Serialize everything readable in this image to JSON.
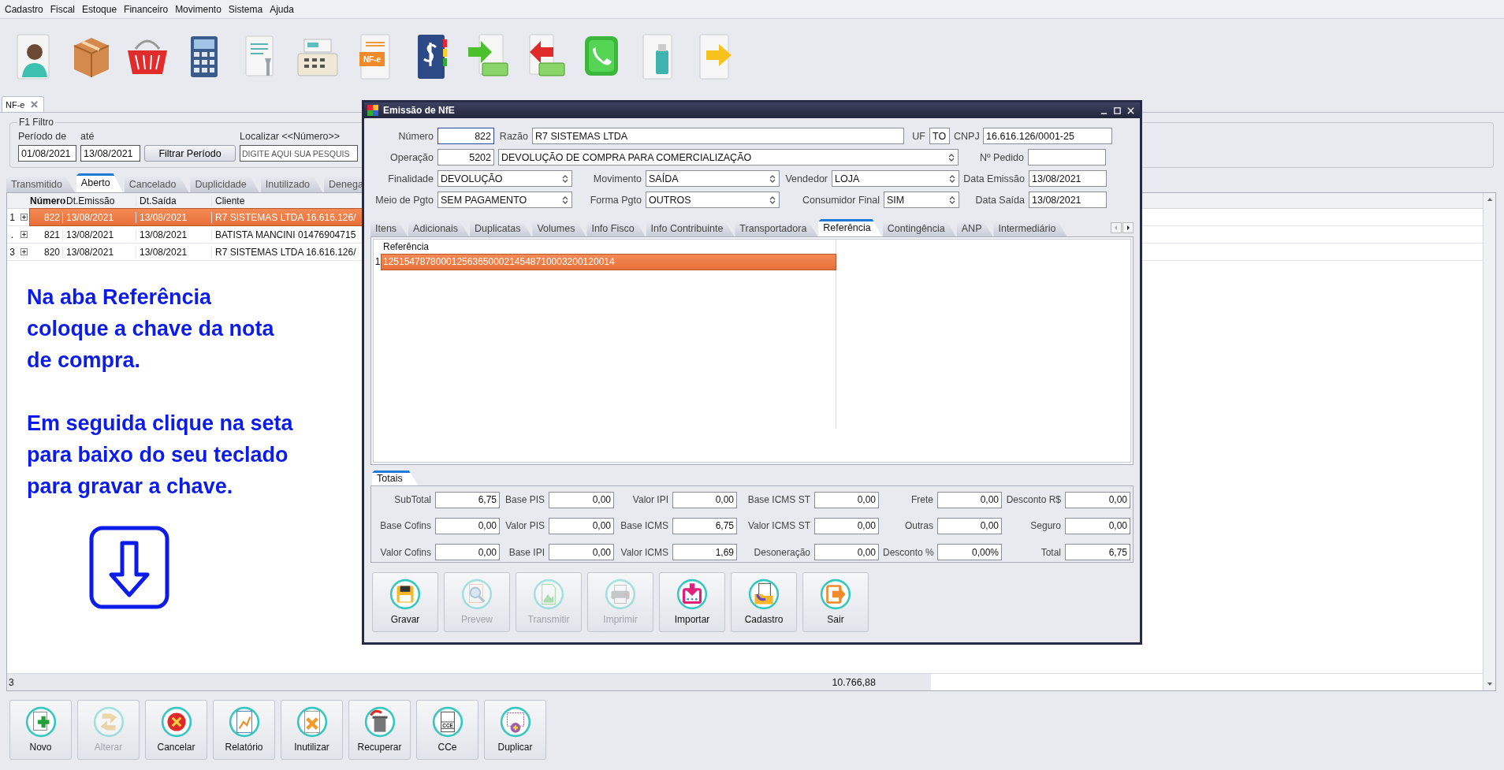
{
  "menu": [
    "Cadastro",
    "Fiscal",
    "Estoque",
    "Financeiro",
    "Movimento",
    "Sistema",
    "Ajuda"
  ],
  "toolbar": {
    "invoice_icon_label": "NF-e"
  },
  "document_tab": {
    "label": "NF-e"
  },
  "filter": {
    "title": "F1 Filtro",
    "from_label": "Período de",
    "from_value": "01/08/2021",
    "to_label": "até",
    "to_value": "13/08/2021",
    "button": "Filtrar Período",
    "search_label": "Localizar <<Número>>",
    "search_placeholder": "DIGITE AQUI SUA PESQUIS"
  },
  "tabs": [
    {
      "label": "Transmitido",
      "selected": false
    },
    {
      "label": "Aberto",
      "selected": true
    },
    {
      "label": "Cancelado",
      "selected": false
    },
    {
      "label": "Duplicidade",
      "selected": false
    },
    {
      "label": "Inutilizado",
      "selected": false
    },
    {
      "label": "Denega",
      "selected": false
    }
  ],
  "table": {
    "columns": [
      "Número",
      "Dt.Emissão",
      "Dt.Saída",
      "Cliente"
    ],
    "rows": [
      {
        "row_number": "1",
        "numero": "822",
        "emissao": "13/08/2021",
        "saida": "13/08/2021",
        "cliente": "R7 SISTEMAS LTDA 16.616.126/",
        "selected": true
      },
      {
        "row_number": ".",
        "numero": "821",
        "emissao": "13/08/2021",
        "saida": "13/08/2021",
        "cliente": "BATISTA MANCINI 01476904715",
        "selected": false
      },
      {
        "row_number": "3",
        "numero": "820",
        "emissao": "13/08/2021",
        "saida": "13/08/2021",
        "cliente": "R7 SISTEMAS LTDA 16.616.126/",
        "selected": false
      }
    ],
    "footer": {
      "count": "3",
      "total": "10.766,88"
    }
  },
  "annotation": {
    "paragraphs": [
      "Na aba Referência\ncoloque a chave da nota\nde compra.",
      "Em seguida clique na seta\npara baixo do seu teclado\npara gravar a chave."
    ]
  },
  "buttons": [
    {
      "label": "Novo",
      "disabled": false
    },
    {
      "label": "Alterar",
      "disabled": true
    },
    {
      "label": "Cancelar",
      "disabled": false
    },
    {
      "label": "Relatório",
      "disabled": false
    },
    {
      "label": "Inutilizar",
      "disabled": false
    },
    {
      "label": "Recuperar",
      "disabled": false
    },
    {
      "label": "CCe",
      "disabled": false,
      "icon_text": "CCE"
    },
    {
      "label": "Duplicar",
      "disabled": false
    }
  ],
  "dialog": {
    "title": "Emissão de NfE",
    "numero": {
      "label": "Número",
      "value": "822"
    },
    "razao": {
      "label": "Razão",
      "value": "R7 SISTEMAS LTDA"
    },
    "uf": {
      "label": "UF",
      "value": "TO"
    },
    "cnpj": {
      "label": "CNPJ",
      "value": "16.616.126/0001-25"
    },
    "operacao": {
      "label": "Operação",
      "code": "5202",
      "value": "DEVOLUÇÃO DE COMPRA PARA COMERCIALIZAÇÃO"
    },
    "pedido": {
      "label": "Nº Pedido"
    },
    "finalidade": {
      "label": "Finalidade",
      "value": "DEVOLUÇÃO"
    },
    "movimento": {
      "label": "Movimento",
      "value": "SAÍDA"
    },
    "vendedor": {
      "label": "Vendedor",
      "value": "LOJA"
    },
    "data_emissao": {
      "label": "Data Emissão",
      "value": "13/08/2021"
    },
    "meio_pgto": {
      "label": "Meio de Pgto",
      "value": "SEM PAGAMENTO"
    },
    "forma_pgto": {
      "label": "Forma Pgto",
      "value": "OUTROS"
    },
    "consumidor_final": {
      "label": "Consumidor Final",
      "value": "SIM"
    },
    "data_saida": {
      "label": "Data Saída",
      "value": "13/08/2021"
    },
    "tabs": [
      {
        "label": "Itens",
        "selected": false
      },
      {
        "label": "Adicionais",
        "selected": false
      },
      {
        "label": "Duplicatas",
        "selected": false
      },
      {
        "label": "Volumes",
        "selected": false
      },
      {
        "label": "Info Fisco",
        "selected": false
      },
      {
        "label": "Info Contribuinte",
        "selected": false
      },
      {
        "label": "Transportadora",
        "selected": false
      },
      {
        "label": "Referência",
        "selected": true
      },
      {
        "label": "Contingência",
        "selected": false
      },
      {
        "label": "ANP",
        "selected": false
      },
      {
        "label": "Intermediário",
        "selected": false
      }
    ],
    "reference": {
      "column": "Referência",
      "rows": [
        {
          "row_number": "1",
          "value": "12515478780001256365000214548710003200120014",
          "selected": true
        }
      ]
    },
    "totals": {
      "tab": "Totais",
      "fields": [
        {
          "label": "SubTotal",
          "value": "6,75"
        },
        {
          "label": "Base PIS",
          "value": "0,00"
        },
        {
          "label": "Valor IPI",
          "value": "0,00"
        },
        {
          "label": "Base ICMS ST",
          "value": "0,00"
        },
        {
          "label": "Frete",
          "value": "0,00"
        },
        {
          "label": "Desconto R$",
          "value": "0,00"
        },
        {
          "label": "Base Cofins",
          "value": "0,00"
        },
        {
          "label": "Valor PIS",
          "value": "0,00"
        },
        {
          "label": "Base ICMS",
          "value": "6,75"
        },
        {
          "label": "Valor ICMS ST",
          "value": "0,00"
        },
        {
          "label": "Outras",
          "value": "0,00"
        },
        {
          "label": "Seguro",
          "value": "0,00"
        },
        {
          "label": "Valor Cofins",
          "value": "0,00"
        },
        {
          "label": "Base IPI",
          "value": "0,00"
        },
        {
          "label": "Valor ICMS",
          "value": "1,69"
        },
        {
          "label": "Desoneração",
          "value": "0,00"
        },
        {
          "label": "Desconto %",
          "value": "0,00%"
        },
        {
          "label": "Total",
          "value": "6,75"
        }
      ]
    },
    "buttons": [
      {
        "label": "Gravar",
        "disabled": false
      },
      {
        "label": "Prevew",
        "disabled": true
      },
      {
        "label": "Transmitir",
        "disabled": true
      },
      {
        "label": "Imprimir",
        "disabled": true
      },
      {
        "label": "Importar",
        "disabled": false
      },
      {
        "label": "Cadastro",
        "disabled": false
      },
      {
        "label": "Sair",
        "disabled": false
      }
    ]
  }
}
